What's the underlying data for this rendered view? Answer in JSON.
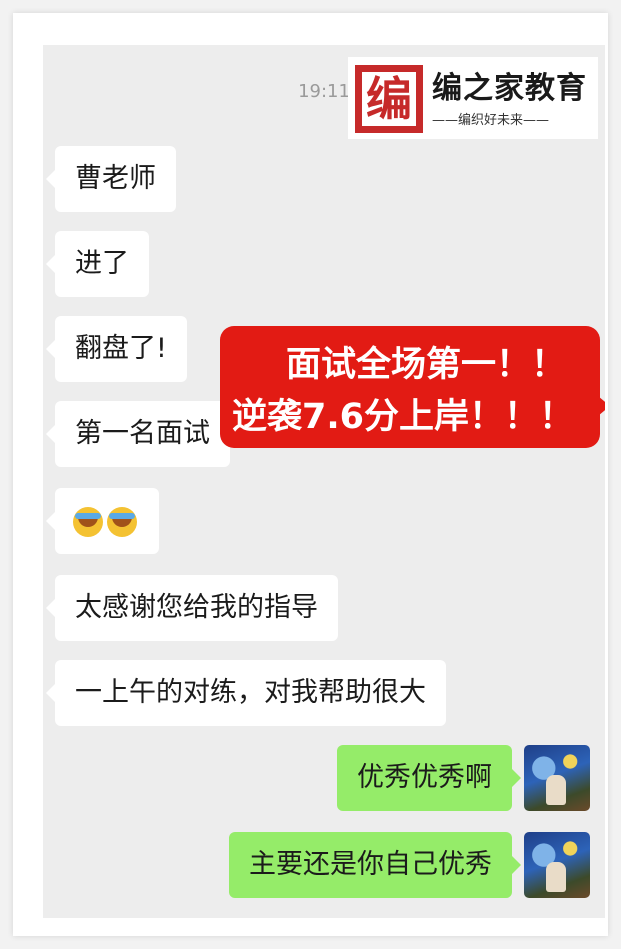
{
  "time": "19:11",
  "brand": {
    "seal_glyph": "编",
    "name": "编之家教育",
    "slogan": "——编织好未来——"
  },
  "messages": [
    {
      "side": "left",
      "text": "曹老师"
    },
    {
      "side": "left",
      "text": "进了"
    },
    {
      "side": "left",
      "text": "翻盘了!"
    },
    {
      "side": "left",
      "text": "第一名面试"
    },
    {
      "side": "left",
      "emoji": [
        "face-with-tears-icon",
        "face-with-tears-icon"
      ]
    },
    {
      "side": "left",
      "text": "太感谢您给我的指导"
    },
    {
      "side": "left",
      "text": "一上午的对练，对我帮助很大"
    },
    {
      "side": "right",
      "text": "优秀优秀啊"
    },
    {
      "side": "right",
      "text": "主要还是你自己优秀"
    }
  ],
  "promo": {
    "line1": "面试全场第一！！",
    "line2": "逆袭7.6分上岸！！！"
  },
  "colors": {
    "chat_bg": "#ededed",
    "incoming": "#ffffff",
    "outgoing": "#95ec69",
    "promo": "#e21b14",
    "seal": "#c62a2a"
  }
}
